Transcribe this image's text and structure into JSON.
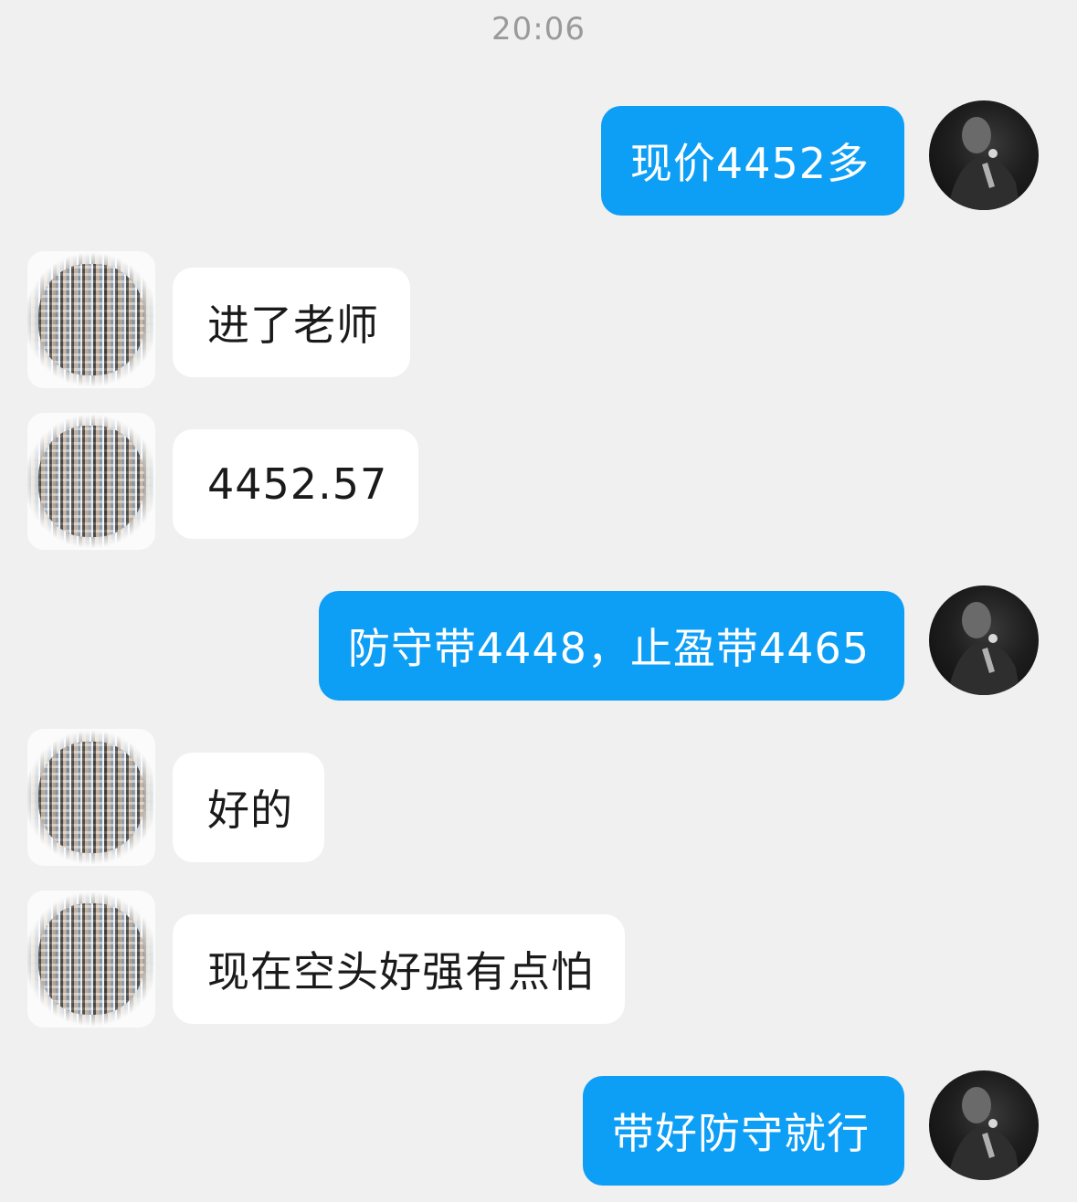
{
  "chat": {
    "timestamp": "20:06",
    "messages": [
      {
        "side": "out",
        "text": "现价4452多"
      },
      {
        "side": "in",
        "text": "进了老师"
      },
      {
        "side": "in",
        "text": "4452.57"
      },
      {
        "side": "out",
        "text": "防守带4448，止盈带4465"
      },
      {
        "side": "in",
        "text": "好的"
      },
      {
        "side": "in",
        "text": "现在空头好强有点怕"
      },
      {
        "side": "out",
        "text": "带好防守就行"
      }
    ]
  },
  "colors": {
    "background": "#f0f0f0",
    "outgoing_bubble": "#0d9ef5",
    "incoming_bubble": "#ffffff",
    "timestamp_text": "#9a9a9a"
  },
  "icons": {
    "self_avatar": "profile-photo-avatar",
    "other_avatar": "pixelated-avatar"
  }
}
